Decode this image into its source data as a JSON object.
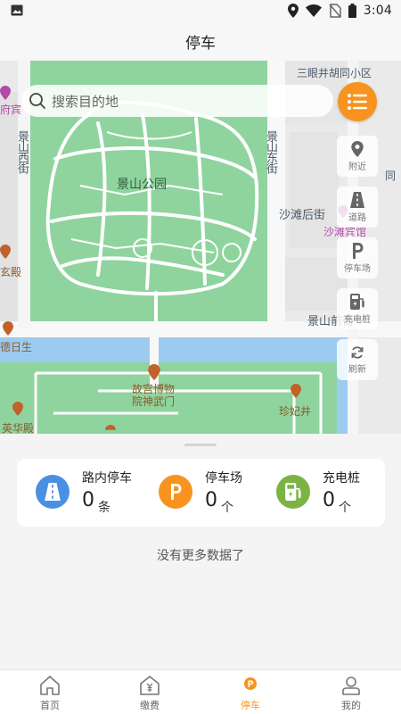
{
  "status_bar": {
    "time": "3:04",
    "icons": [
      "image-icon",
      "location-icon",
      "wifi-icon",
      "no-sim-icon",
      "battery-icon"
    ]
  },
  "header": {
    "title": "停车"
  },
  "map": {
    "search_placeholder": "搜索目的地",
    "labels": {
      "sanyan": "三眼井胡同小区",
      "jingshan_park": "景山公园",
      "jingshan_west": "景山西街",
      "jingshan_east": "景山东街",
      "shatan_back": "沙滩后街",
      "shatan_hotel": "沙滩宾馆",
      "jingshan_front": "景山前街",
      "gate": "故宫博物院神武门",
      "zhenfei": "珍妃井",
      "yinghua": "英华殿",
      "xuan": "玄殿",
      "ri": "德日生",
      "fu": "府宾",
      "tong": "同"
    },
    "side_buttons": {
      "nearby": "附近",
      "road": "道路",
      "parking_lot": "停车场",
      "charging": "充电桩",
      "refresh": "刷新"
    }
  },
  "summary": {
    "road_parking": {
      "label": "路内停车",
      "count": "0",
      "unit": "条"
    },
    "parking_lot": {
      "label": "停车场",
      "count": "0",
      "unit": "个"
    },
    "charging": {
      "label": "充电桩",
      "count": "0",
      "unit": "个"
    },
    "empty_text": "没有更多数据了"
  },
  "tabs": [
    {
      "label": "首页",
      "icon": "home-icon"
    },
    {
      "label": "缴费",
      "icon": "payment-icon"
    },
    {
      "label": "停车",
      "icon": "parking-icon",
      "active": true
    },
    {
      "label": "我的",
      "icon": "profile-icon"
    }
  ],
  "colors": {
    "accent": "#f7931e",
    "road_blue": "#4a90e2",
    "lot_orange": "#f7931e",
    "charge_green": "#7cb342",
    "park_green": "#8fd49e",
    "water_blue": "#9ccbf0"
  }
}
